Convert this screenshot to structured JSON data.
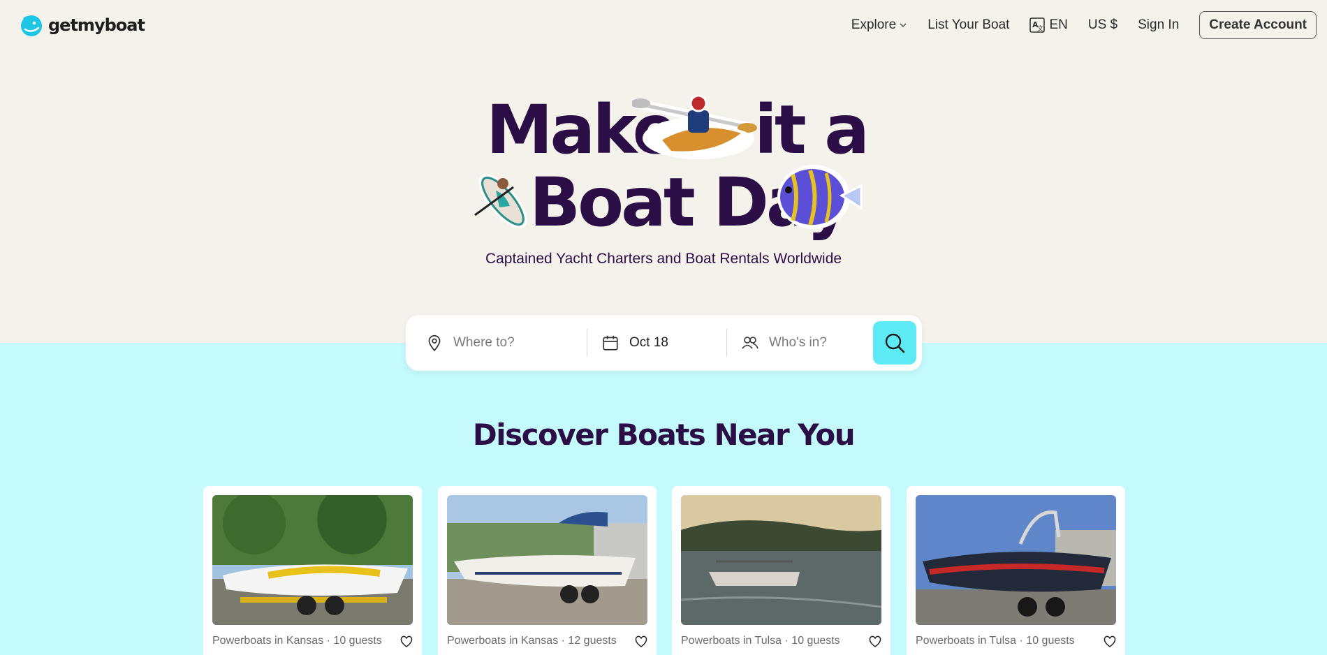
{
  "header": {
    "logo_text": "getmyboat",
    "nav": {
      "explore": "Explore",
      "list_boat": "List Your Boat",
      "language": "EN",
      "currency": "US $",
      "sign_in": "Sign In",
      "create_account": "Create Account"
    }
  },
  "hero": {
    "headline_line1_a": "Make",
    "headline_line1_b": "it a",
    "headline_line2": "Boat Day",
    "subtitle": "Captained Yacht Charters and Boat Rentals Worldwide"
  },
  "search": {
    "where_placeholder": "Where to?",
    "date_value": "Oct 18",
    "who_placeholder": "Who's in?"
  },
  "section": {
    "title": "Discover Boats Near You"
  },
  "listings": [
    {
      "meta": "Powerboats in Kansas · 10 guests"
    },
    {
      "meta": "Powerboats in Kansas · 12 guests"
    },
    {
      "meta": "Powerboats in Tulsa · 10 guests"
    },
    {
      "meta": "Powerboats in Tulsa · 10 guests"
    }
  ],
  "colors": {
    "hero_bg": "#f5f2ec",
    "page_bg": "#c4fafc",
    "headline": "#2c0e46",
    "search_button": "#5eeaf4",
    "brand": "#1ec6e6"
  }
}
